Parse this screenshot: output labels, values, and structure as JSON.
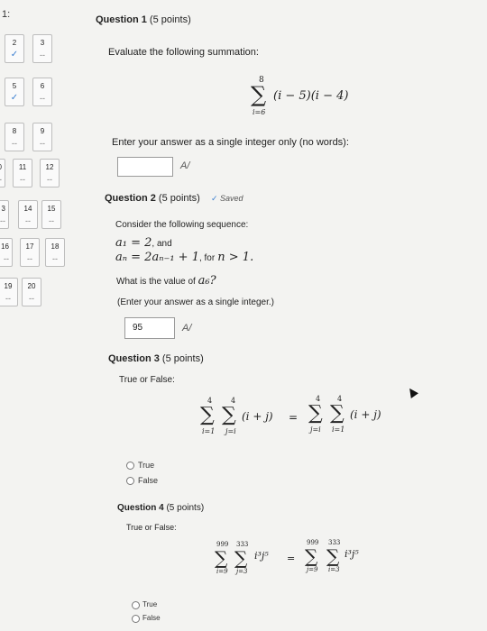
{
  "timer_label": "1:",
  "nav": [
    {
      "num": "2",
      "status": "✓"
    },
    {
      "num": "3",
      "status": "--"
    },
    {
      "num": "5",
      "status": "✓"
    },
    {
      "num": "6",
      "status": "--"
    },
    {
      "num": "8",
      "status": "--"
    },
    {
      "num": "9",
      "status": "--"
    },
    {
      "num": "11",
      "status": "--"
    },
    {
      "num": "12",
      "status": "--"
    },
    {
      "num": "14",
      "status": "--"
    },
    {
      "num": "15",
      "status": "--"
    },
    {
      "num": "17",
      "status": "--"
    },
    {
      "num": "18",
      "status": "--"
    },
    {
      "num": "20",
      "status": "--"
    }
  ],
  "nav_partial": [
    {
      "num": "0",
      "status": "--"
    },
    {
      "num": "3",
      "status": "--"
    },
    {
      "num": "16",
      "status": "--"
    },
    {
      "num": "19",
      "status": "--"
    }
  ],
  "q1": {
    "title": "Question 1",
    "points": "(5 points)",
    "prompt": "Evaluate the following summation:",
    "sum_upper": "8",
    "sum_lower": "i=6",
    "expr": "(i − 5)(i − 4)",
    "instruction": "Enter your answer as a single integer only (no words):",
    "answer": ""
  },
  "q2": {
    "title": "Question 2",
    "points": "(5 points)",
    "saved": "Saved",
    "prompt": "Consider the following sequence:",
    "line1_math": "a₁ = 2",
    "line1_text": ", and",
    "line2_math": "aₙ = 2aₙ₋₁ + 1",
    "line2_text": ", for",
    "line2_cond": "n > 1.",
    "question": "What is the value of",
    "question_var": "a₆?",
    "instruction": "(Enter your answer as a single integer.)",
    "answer": "95"
  },
  "q3": {
    "title": "Question 3",
    "points": "(5 points)",
    "prompt": "True or False:",
    "left_up1": "4",
    "left_up2": "4",
    "left_lo1": "i=1",
    "left_lo2": "j=i",
    "left_expr": "(i + j)",
    "eq": "=",
    "right_up1": "4",
    "right_up2": "4",
    "right_lo1": "j=i",
    "right_lo2": "i=1",
    "right_expr": "(i + j)",
    "opt_true": "True",
    "opt_false": "False"
  },
  "q4": {
    "title": "Question 4",
    "points": "(5 points)",
    "prompt": "True or False:",
    "left_up1": "999",
    "left_up2": "333",
    "left_lo1": "i=9",
    "left_lo2": "j=3",
    "left_expr": "i³j⁵",
    "eq": "=",
    "right_up1": "999",
    "right_up2": "333",
    "right_lo1": "j=9",
    "right_lo2": "i=3",
    "right_expr": "i³j⁵",
    "opt_true": "True",
    "opt_false": "False"
  }
}
